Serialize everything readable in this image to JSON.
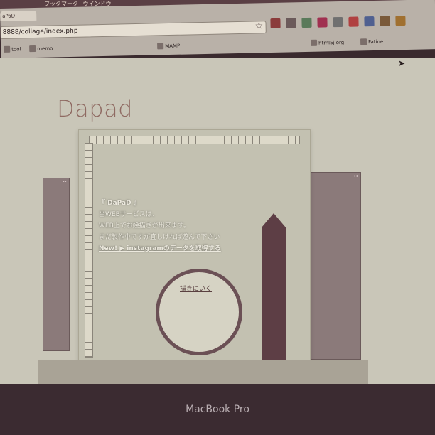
{
  "menubar": {
    "items": [
      "ブックマーク",
      "ウインドウ"
    ]
  },
  "browser": {
    "tab_title": "aPaD",
    "url": "8888/collage/index.php",
    "bookmarks": [
      {
        "label": "tool"
      },
      {
        "label": "memo"
      },
      {
        "label": "MAMP"
      },
      {
        "label": "html5j.org"
      },
      {
        "label": "Fatine"
      }
    ],
    "extension_colors": [
      "#8b3b3b",
      "#6b5a5a",
      "#a03050",
      "#5a7a5a",
      "#707070",
      "#b04040",
      "#506090"
    ]
  },
  "page": {
    "logo": "Dapad",
    "intro": {
      "title": "『 DaPaD 』",
      "line1": "当WEBサービスは、",
      "line2": "WEB上でお絵描きが出来ます。",
      "line3": "まだ製作中ですが宜しければ遊んで下さい",
      "news": "New! ▶ instagramのデータを取得する"
    },
    "draw_link": "描きにいく"
  },
  "device": {
    "brand": "MacBook Pro"
  }
}
